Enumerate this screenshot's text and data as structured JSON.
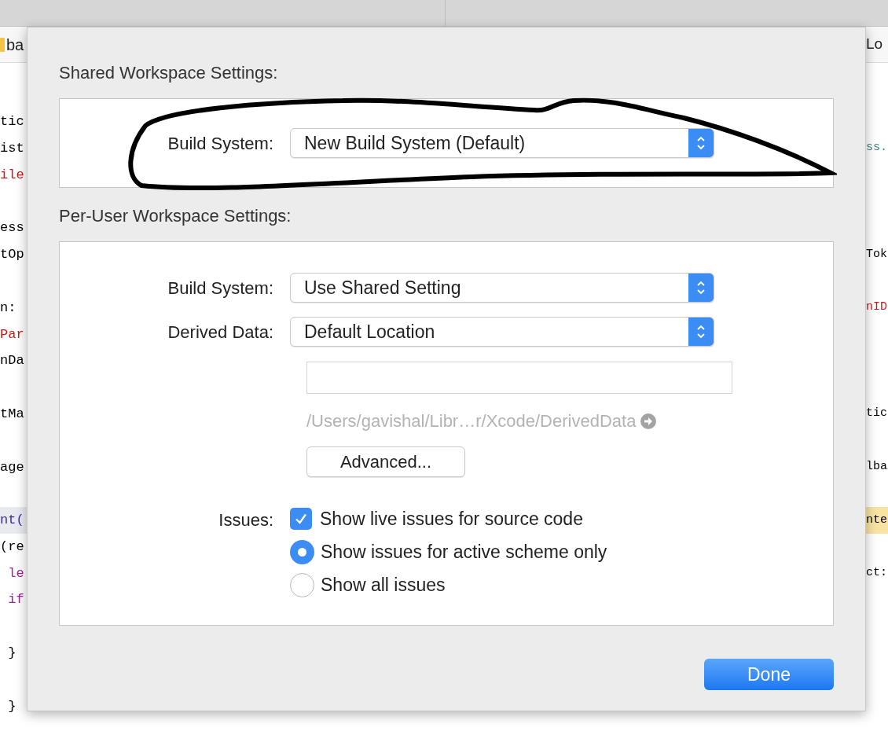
{
  "background_editor": {
    "left_tab": "ba",
    "right_tab": "Lo",
    "lines": [
      {
        "kind": "code",
        "highlighted": false,
        "left": {
          "text": "tic",
          "color": "#000000"
        }
      },
      {
        "kind": "code",
        "highlighted": false,
        "left": {
          "text": "ist",
          "color": "#000000"
        },
        "right": {
          "text": "ss.",
          "color": "#3e8087"
        }
      },
      {
        "kind": "code",
        "highlighted": false,
        "left": {
          "text": "ile",
          "color": "#c41a16"
        }
      },
      {
        "kind": "blank"
      },
      {
        "kind": "code",
        "highlighted": false,
        "left": {
          "text": "ess",
          "color": "#000000"
        }
      },
      {
        "kind": "code",
        "highlighted": false,
        "left": {
          "text": "tOp",
          "color": "#000000"
        },
        "right": {
          "text": "Tok",
          "color": "#000000"
        }
      },
      {
        "kind": "blank"
      },
      {
        "kind": "code",
        "highlighted": false,
        "left": {
          "text": "n:",
          "color": "#000000"
        },
        "right": {
          "text": "nID",
          "color": "#c41a16"
        }
      },
      {
        "kind": "code",
        "highlighted": false,
        "left": {
          "text": "Par",
          "color": "#c41a16"
        }
      },
      {
        "kind": "code",
        "highlighted": false,
        "left": {
          "text": "nDa",
          "color": "#000000"
        }
      },
      {
        "kind": "blank"
      },
      {
        "kind": "code",
        "highlighted": false,
        "left": {
          "text": "tMa",
          "color": "#000000"
        },
        "right": {
          "text": "tic",
          "color": "#000000"
        }
      },
      {
        "kind": "blank"
      },
      {
        "kind": "code",
        "highlighted": false,
        "left": {
          "text": "age",
          "color": "#000000"
        },
        "right": {
          "text": "lba",
          "color": "#000000"
        }
      },
      {
        "kind": "blank"
      },
      {
        "kind": "code",
        "highlighted": true,
        "left": {
          "text": "nt(",
          "color": "#3a2ea0"
        },
        "right": {
          "text": "nte",
          "color": "#000000"
        }
      },
      {
        "kind": "code",
        "highlighted": false,
        "left": {
          "text": "(re",
          "color": "#000000"
        }
      },
      {
        "kind": "code",
        "highlighted": false,
        "left": {
          "text": " le",
          "color": "#9b2393"
        },
        "right": {
          "text": "ct:",
          "color": "#000000"
        }
      },
      {
        "kind": "code",
        "highlighted": false,
        "left": {
          "text": " if",
          "color": "#9b2393"
        }
      },
      {
        "kind": "blank"
      },
      {
        "kind": "code",
        "highlighted": false,
        "left": {
          "text": " }",
          "color": "#000000"
        }
      },
      {
        "kind": "blank"
      },
      {
        "kind": "code",
        "highlighted": false,
        "left": {
          "text": " }",
          "color": "#000000"
        }
      }
    ]
  },
  "dialog": {
    "shared_heading": "Shared Workspace Settings:",
    "shared_build_system": {
      "label": "Build System:",
      "value": "New Build System (Default)"
    },
    "per_user_heading": "Per-User Workspace Settings:",
    "per_user_build_system": {
      "label": "Build System:",
      "value": "Use Shared Setting"
    },
    "derived_data": {
      "label": "Derived Data:",
      "value": "Default Location",
      "path": "/Users/gavishal/Libr…r/Xcode/DerivedData"
    },
    "advanced_button": "Advanced...",
    "issues": {
      "label": "Issues:",
      "checkbox": {
        "label": "Show live issues for source code",
        "checked": true
      },
      "radios": [
        {
          "label": "Show issues for active scheme only",
          "selected": true
        },
        {
          "label": "Show all issues",
          "selected": false
        }
      ]
    },
    "done_button": "Done"
  }
}
